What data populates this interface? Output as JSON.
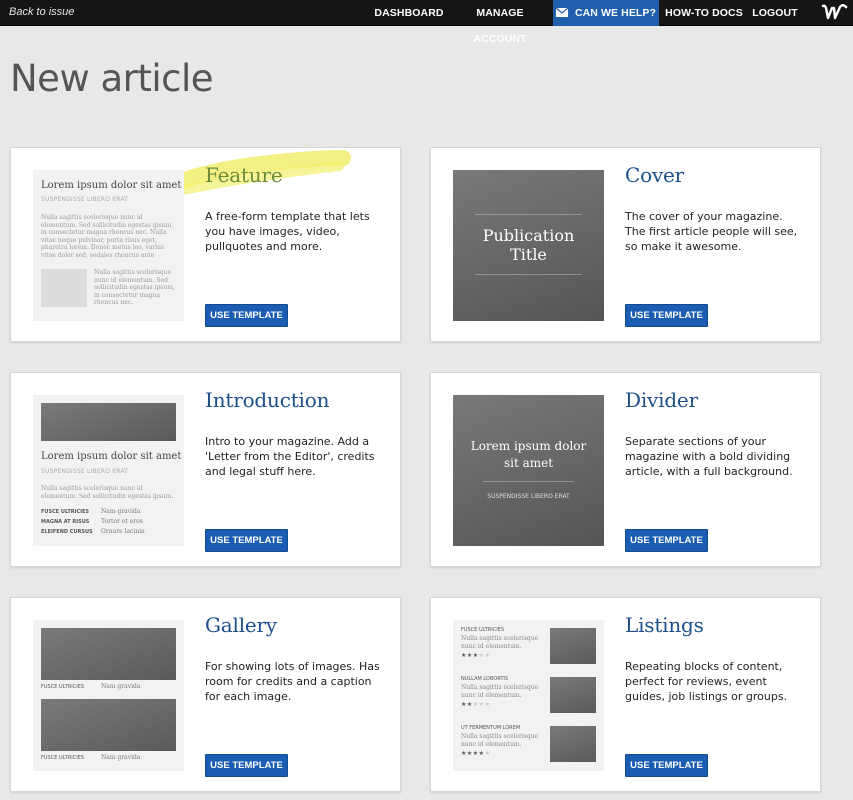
{
  "topbar": {
    "back_label": "Back to issue",
    "nav": {
      "dashboard": "DASHBOARD",
      "manage": "MANAGE ACCOUNT",
      "help": "CAN WE HELP?",
      "howto": "HOW-TO DOCS",
      "logout": "LOGOUT"
    },
    "help_icon": "mail-icon",
    "logo_icon": "w-logo-icon",
    "help_color": "#1f5fae"
  },
  "page_title": "New article",
  "button_label": "USE TEMPLATE",
  "templates": {
    "feature": {
      "title": "Feature",
      "description": "A free-form template that lets you have images, video, pullquotes and more.",
      "thumb": {
        "headline": "Lorem ipsum dolor sit amet",
        "kicker": "SUSPENDISSE LIBERO ERAT",
        "body": "Nulla sagittis scelerisque nunc id elementum. Sed sollicitudin egestas ipsum, in consectetur magna rhoncus nec. Nulla vitae neque pulvinar, porta risus eget, pharetra lorem. Donec metus leo, varius vitae dolor sed, sodales rhoncus ante",
        "side_text": "Nulla sagittis scelerisque nunc id elementum. Sed sollicitudin egestas ipsum, in consectetur magna rhoncus nec."
      }
    },
    "cover": {
      "title": "Cover",
      "description": "The cover of your magazine. The first article people will see, so make it awesome.",
      "thumb": {
        "line1": "Publication",
        "line2": "Title"
      }
    },
    "introduction": {
      "title": "Introduction",
      "description": "Intro to your magazine. Add a 'Letter from the Editor', credits and legal stuff here.",
      "thumb": {
        "headline": "Lorem ipsum dolor sit amet",
        "kicker": "SUSPENDISSE LIBERO ERAT",
        "body": "Nulla sagittis scelerisque nunc id elementum. Sed sollicitudin egestas ipsum.",
        "credits": [
          {
            "label": "FUSCE ULTRICIES",
            "value": "Nam gravida"
          },
          {
            "label": "MAGNA AT RISUS",
            "value": "Tortor et eros"
          },
          {
            "label": "ELEIFEND CURSUS",
            "value": "Ornare lacinia"
          }
        ]
      }
    },
    "divider": {
      "title": "Divider",
      "description": "Separate sections of your magazine with a bold dividing article, with a full background.",
      "thumb": {
        "headline1": "Lorem ipsum dolor",
        "headline2": "sit amet",
        "kicker": "SUSPENDISSE LIBERO ERAT"
      }
    },
    "gallery": {
      "title": "Gallery",
      "description": "For showing lots of images. Has room for credits and a caption for each image.",
      "thumb": {
        "captions": [
          {
            "label": "FUSCE ULTRICIES",
            "value": "Nam gravida"
          },
          {
            "label": "FUSCE ULTRICIES",
            "value": "Nam gravida"
          }
        ]
      }
    },
    "listings": {
      "title": "Listings",
      "description": "Repeating blocks of content, perfect for reviews, event guides, job listings or groups.",
      "thumb": {
        "items": [
          {
            "label": "FUSCE ULTRICIES",
            "text": "Nulla sagittis scelerisque nunc id elementum.",
            "rating": 3
          },
          {
            "label": "NULLAM LOBORTIS",
            "text": "Nulla sagittis scelerisque nunc id elementum.",
            "rating": 2
          },
          {
            "label": "UT FERMENTUM LOREM",
            "text": "Nulla sagittis scelerisque nunc id elementum.",
            "rating": 4
          }
        ],
        "rating_max": 5
      }
    }
  }
}
